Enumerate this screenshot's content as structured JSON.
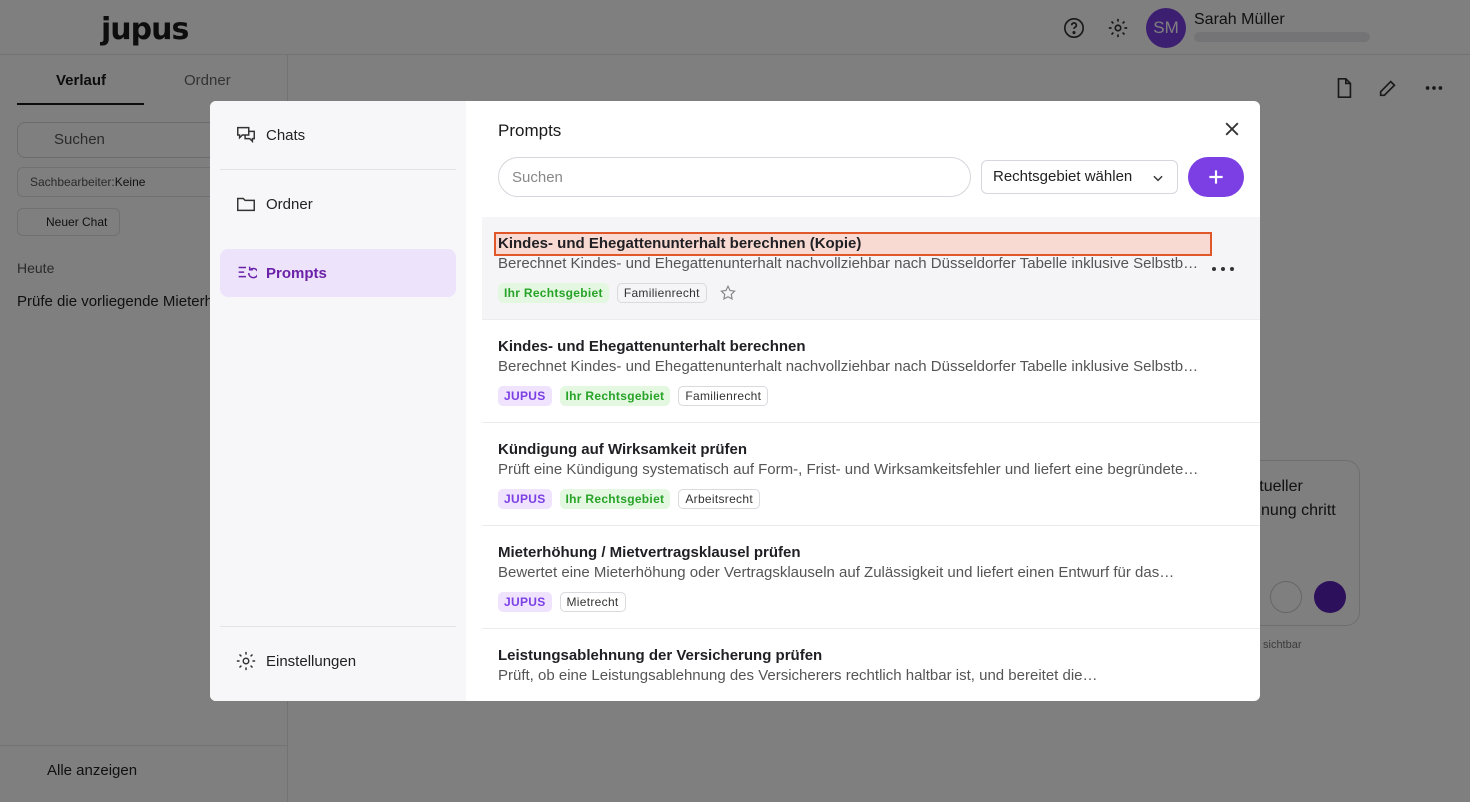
{
  "app": {
    "logo": "jupus",
    "user": {
      "initials": "SM",
      "name": "Sarah Müller"
    }
  },
  "sidebar": {
    "tabs": [
      "Verlauf",
      "Ordner"
    ],
    "search_placeholder": "Suchen",
    "filter_label": "Sachbearbeiter:",
    "filter_value": "Keine",
    "new_chat": "Neuer Chat",
    "section_today": "Heute",
    "recent_item": "Prüfe die vorliegende Mieterhöhung",
    "show_all": "Alle anzeigen"
  },
  "composer": {
    "text": "ch aktueller erechnung chritt dar",
    "note": "sichtbar"
  },
  "modal": {
    "nav": {
      "chats": "Chats",
      "folders": "Ordner",
      "prompts": "Prompts",
      "settings": "Einstellungen"
    },
    "title": "Prompts",
    "search_placeholder": "Suchen",
    "area_select": "Rechtsgebiet wählen",
    "prompts": [
      {
        "title": "Kindes- und Ehegattenunterhalt berechnen (Kopie)",
        "description": "Berechnet Kindes- und Ehegattenunterhalt nachvollziehbar nach Düsseldorfer Tabelle inklusive Selbstbehalt",
        "tags": [
          {
            "type": "area",
            "label": "Ihr Rechtsgebiet"
          },
          {
            "type": "topic",
            "label": "Familienrecht"
          }
        ]
      },
      {
        "title": "Kindes- und Ehegattenunterhalt berechnen",
        "description": "Berechnet Kindes- und Ehegattenunterhalt nachvollziehbar nach Düsseldorfer Tabelle inklusive Selbstbehalt",
        "tags": [
          {
            "type": "jupus",
            "label": "JUPUS"
          },
          {
            "type": "area",
            "label": "Ihr Rechtsgebiet"
          },
          {
            "type": "topic",
            "label": "Familienrecht"
          }
        ]
      },
      {
        "title": "Kündigung auf Wirksamkeit prüfen",
        "description": "Prüft eine Kündigung systematisch auf Form-, Frist- und Wirksamkeitsfehler und liefert eine begründete…",
        "tags": [
          {
            "type": "jupus",
            "label": "JUPUS"
          },
          {
            "type": "area",
            "label": "Ihr Rechtsgebiet"
          },
          {
            "type": "topic",
            "label": "Arbeitsrecht"
          }
        ]
      },
      {
        "title": "Mieterhöhung / Mietvertragsklausel prüfen",
        "description": "Bewertet eine Mieterhöhung oder Vertragsklauseln auf Zulässigkeit und liefert einen Entwurf für das…",
        "tags": [
          {
            "type": "jupus",
            "label": "JUPUS"
          },
          {
            "type": "topic",
            "label": "Mietrecht"
          }
        ]
      },
      {
        "title": "Leistungsablehnung der Versicherung prüfen",
        "description": "Prüft, ob eine Leistungsablehnung des Versicherers rechtlich haltbar ist, und bereitet die…",
        "tags": []
      }
    ]
  },
  "colors": {
    "accent": "#7b3fe4",
    "area_green": "#27a327",
    "highlight_border": "#e0582a"
  }
}
